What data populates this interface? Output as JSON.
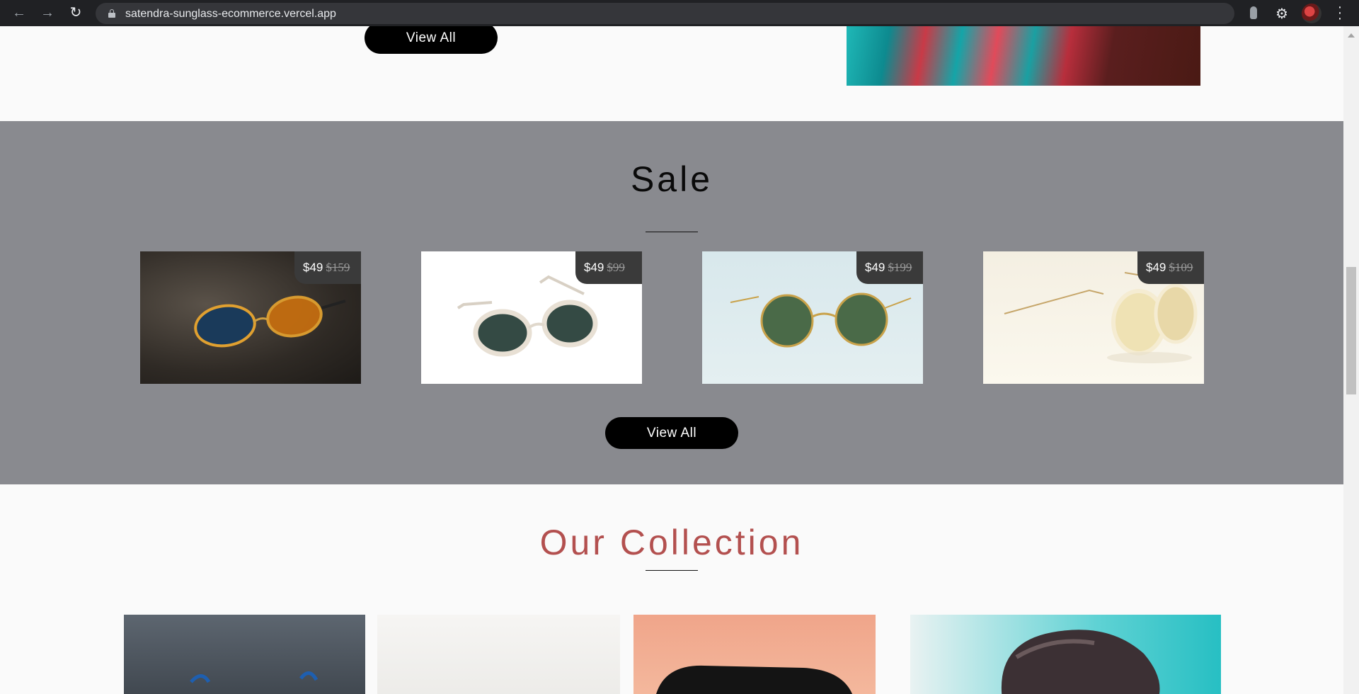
{
  "browser": {
    "url": "satendra-sunglass-ecommerce.vercel.app",
    "icons": [
      "back-icon",
      "forward-icon",
      "reload-icon",
      "lock-icon",
      "star-icon",
      "extension-icon",
      "puzzle-icon",
      "profile-avatar",
      "more-icon"
    ]
  },
  "top_section": {
    "view_all_label": "View All"
  },
  "sale": {
    "title": "Sale",
    "view_all_label": "View All",
    "products": [
      {
        "price": "$49",
        "old_price": "$159"
      },
      {
        "price": "$49",
        "old_price": "$99"
      },
      {
        "price": "$49",
        "old_price": "$199"
      },
      {
        "price": "$49",
        "old_price": "$109"
      }
    ]
  },
  "collection": {
    "title": "Our Collection"
  },
  "colors": {
    "sale_bg": "#898a8f",
    "collection_title": "#b3504f",
    "button_bg": "#000000"
  }
}
